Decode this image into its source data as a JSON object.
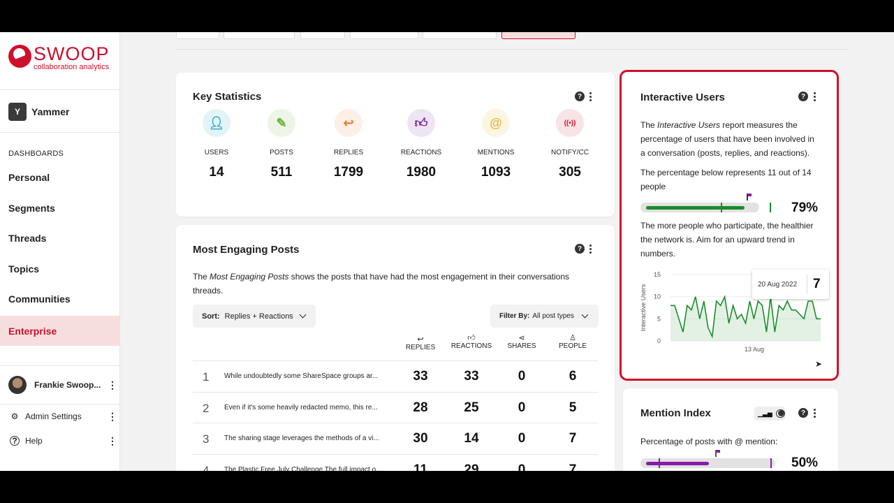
{
  "brand": {
    "title": "SWOOP",
    "subtitle": "collaboration analytics",
    "color": "#c8102e"
  },
  "platform": {
    "label": "Yammer",
    "icon": "yammer-icon"
  },
  "sidebar": {
    "section_label": "DASHBOARDS",
    "items": [
      {
        "label": "Personal"
      },
      {
        "label": "Segments"
      },
      {
        "label": "Threads"
      },
      {
        "label": "Topics"
      },
      {
        "label": "Communities"
      },
      {
        "label": "Enterprise",
        "active": true
      }
    ],
    "user": {
      "name": "Frankie Swoop..."
    },
    "admin_label": "Admin Settings",
    "help_label": "Help"
  },
  "key_stats": {
    "title": "Key Statistics",
    "items": [
      {
        "label": "USERS",
        "value": "14",
        "icon": "user-icon",
        "color": "#29a8c8",
        "bg": "#e3f4f8"
      },
      {
        "label": "POSTS",
        "value": "511",
        "icon": "edit-icon",
        "color": "#6eb23c",
        "bg": "#edf6e6"
      },
      {
        "label": "REPLIES",
        "value": "1799",
        "icon": "reply-icon",
        "color": "#e8833a",
        "bg": "#fcefe5"
      },
      {
        "label": "REACTIONS",
        "value": "1980",
        "icon": "thumbs-up-icon",
        "color": "#7a2a92",
        "bg": "#efe4f3"
      },
      {
        "label": "MENTIONS",
        "value": "1093",
        "icon": "at-icon",
        "color": "#e9b53a",
        "bg": "#fcf5e2"
      },
      {
        "label": "NOTIFY/CC",
        "value": "305",
        "icon": "broadcast-icon",
        "color": "#d0102b",
        "bg": "#f8e3e6"
      }
    ]
  },
  "posts": {
    "title": "Most Engaging Posts",
    "desc_prefix": "The ",
    "desc_em": "Most Engaging Posts",
    "desc_line1": " shows the posts that have had the most engagement in their conversations",
    "desc_line2": "threads.",
    "sort_label": "Sort:",
    "sort_value": "Replies + Reactions",
    "filter_label": "Filter By:",
    "filter_value": "All post types",
    "columns": [
      {
        "label": "REPLIES",
        "icon": "reply-icon"
      },
      {
        "label": "REACTIONS",
        "icon": "thumbs-up-icon"
      },
      {
        "label": "SHARES",
        "icon": "share-icon"
      },
      {
        "label": "PEOPLE",
        "icon": "person-icon"
      }
    ],
    "rows": [
      {
        "num": "1",
        "title": "While undoubtedly some ShareSpace groups ar...",
        "replies": "33",
        "reactions": "33",
        "shares": "0",
        "people": "6"
      },
      {
        "num": "2",
        "title": "Even if it's some heavily redacted memo, this re...",
        "replies": "28",
        "reactions": "25",
        "shares": "0",
        "people": "5"
      },
      {
        "num": "3",
        "title": "The sharing stage leverages the methods of a vi...",
        "replies": "30",
        "reactions": "14",
        "shares": "0",
        "people": "7"
      },
      {
        "num": "4",
        "title": "The Plastic Free July Challenge The full impact o...",
        "replies": "11",
        "reactions": "29",
        "shares": "0",
        "people": "7"
      }
    ]
  },
  "interactive": {
    "title": "Interactive Users",
    "p1_prefix": "The ",
    "p1_em": "Interactive Users",
    "p1_rest_l1": " report measures the",
    "p1_l2": "percentage of users that have been involved in",
    "p1_l3": "a conversation (posts, replies, and reactions).",
    "p2_l1": "The percentage below represents 11 out of 14",
    "p2_l2": "people",
    "percent": "79%",
    "progress": 0.79,
    "p3_l1": "The more people who participate, the healthier",
    "p3_l2": "the network is. Aim for an upward trend in",
    "p3_l3": "numbers.",
    "accent": "#1a8c2a"
  },
  "chart_data": {
    "type": "area",
    "ylabel": "Interactive Users",
    "yticks": [
      "15",
      "10",
      "5",
      "0"
    ],
    "ylim": [
      0,
      15
    ],
    "xtick_label": "13 Aug",
    "values": [
      8,
      8,
      5,
      2,
      8,
      7,
      10,
      5,
      9,
      3,
      1,
      9,
      8,
      10,
      4,
      8,
      5,
      6,
      4,
      9,
      5,
      9,
      8,
      2,
      10,
      2,
      8,
      7,
      9,
      7,
      7,
      6,
      5,
      9,
      9,
      5,
      5
    ],
    "tooltip": {
      "date": "20 Aug 2022",
      "value": "7"
    },
    "color": "#1a8c2a"
  },
  "mention": {
    "title": "Mention Index",
    "desc": "Percentage of posts with @ mention:",
    "percent": "50%",
    "progress": 0.5,
    "accent": "#8a1aa8"
  }
}
